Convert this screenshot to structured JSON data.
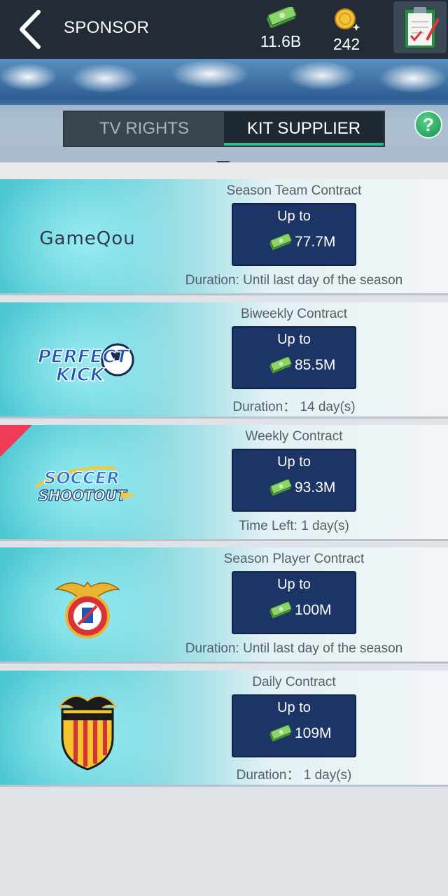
{
  "header": {
    "title": "SPONSOR",
    "cash": "11.6B",
    "coins": "242"
  },
  "tabs": [
    {
      "label": "TV RIGHTS",
      "active": false
    },
    {
      "label": "KIT SUPPLIER",
      "active": true
    }
  ],
  "help_label": "?",
  "offer_label": "Up to",
  "sponsors": [
    {
      "logo": "GameQou",
      "type": "Season Team Contract",
      "amount": "77.7M",
      "duration": "Duration: Until last day of the season"
    },
    {
      "logo": "PERFECT KICK",
      "type": "Biweekly Contract",
      "amount": "85.5M",
      "duration": "Duration： 14 day(s)"
    },
    {
      "logo": "SOCCER SHOOT OUT",
      "type": "Weekly Contract",
      "amount": "93.3M",
      "duration": "Time Left: 1 day(s)"
    },
    {
      "logo": "benfica-crest",
      "type": "Season Player Contract",
      "amount": "100M",
      "duration": "Duration: Until last day of the season"
    },
    {
      "logo": "VALENCIA C.F.",
      "type": "Daily Contract",
      "amount": "109M",
      "duration": "Duration： 1 day(s)"
    }
  ],
  "colors": {
    "topbar": "#232c36",
    "offer_box": "#1c3566",
    "tab_accent": "#36b58e",
    "new_flag": "#ee3b56"
  }
}
